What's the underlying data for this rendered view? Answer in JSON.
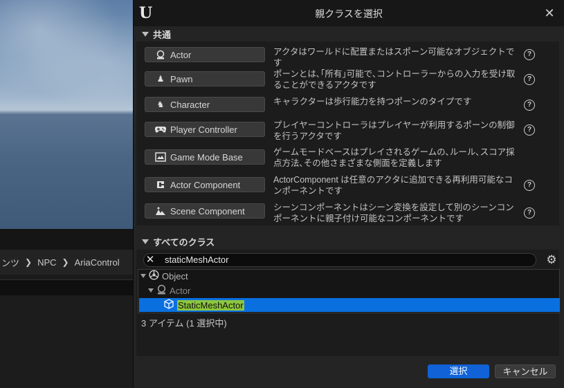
{
  "editor": {
    "breadcrumb": [
      "ンツ",
      "NPC",
      "AriaControl"
    ]
  },
  "dialog": {
    "title": "親クラスを選択",
    "common_section": "共通",
    "common_classes": [
      {
        "label": "Actor",
        "icon": "actor-icon",
        "desc": "アクタはワールドに配置またはスポーン可能なオブジェクトです"
      },
      {
        "label": "Pawn",
        "icon": "pawn-icon",
        "desc": "ポーンとは､｢所有｣可能で､コントローラーからの入力を受け取ることができるアクタです"
      },
      {
        "label": "Character",
        "icon": "character-icon",
        "desc": "キャラクターは歩行能力を持つポーンのタイプです"
      },
      {
        "label": "Player Controller",
        "icon": "gamepad-icon",
        "desc": "プレイヤーコントローラはプレイヤーが利用するポーンの制御を行うアクタです"
      },
      {
        "label": "Game Mode Base",
        "icon": "game-mode-icon",
        "desc": "ゲームモードベースはプレイされるゲームの､ルール､スコア採点方法､その他さまざまな側面を定義します"
      },
      {
        "label": "Actor Component",
        "icon": "actor-component-icon",
        "desc": "ActorComponent は任意のアクタに追加できる再利用可能なコンポーネントです"
      },
      {
        "label": "Scene Component",
        "icon": "scene-component-icon",
        "desc": "シーンコンポーネントはシーン変換を設定して別のシーンコンポーネントに親子付け可能なコンポーネントです"
      }
    ],
    "all_section": "すべてのクラス",
    "search": {
      "value": "staticMeshActor"
    },
    "tree": {
      "object": "Object",
      "actor": "Actor",
      "selected": "StaticMeshActor"
    },
    "status": "3 アイテム (1 選択中)",
    "select_button": "選択",
    "cancel_button": "キャンセル"
  },
  "colors": {
    "accent": "#1062d6",
    "selection": "#0a70e0",
    "highlight": "#8dc63f"
  }
}
